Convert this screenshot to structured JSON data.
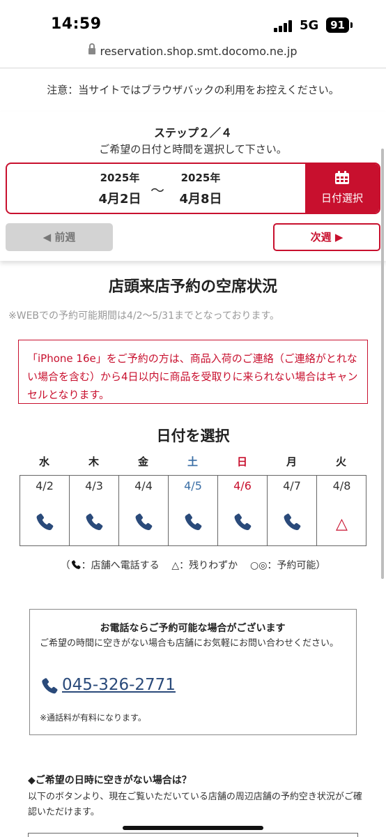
{
  "status_bar": {
    "time": "14:59",
    "network": "5G",
    "battery": "91"
  },
  "browser": {
    "url": "reservation.shop.smt.docomo.ne.jp"
  },
  "notice": "注意：当サイトではブラウザバックの利用をお控えください。",
  "step": {
    "label": "ステップ２／４",
    "instruction": "ご希望の日付と時間を選択して下さい。"
  },
  "date_range": {
    "from_year": "2025年",
    "from_date": "4月2日",
    "separator": "〜",
    "to_year": "2025年",
    "to_date": "4月8日",
    "select_label": "日付選択"
  },
  "nav": {
    "prev_label": "◀ 前週",
    "next_label": "次週 ▶"
  },
  "section_title": "店頭来店予約の空席状況",
  "period_note": "※WEBでの予約可能期間は4/2〜5/31までとなっております。",
  "warning": "「iPhone 16e」をご予約の方は、商品入荷のご連絡（ご連絡がとれない場合を含む）から4日以内に商品を受取りに来られない場合はキャンセルとなります。",
  "date_select_title": "日付を選択",
  "calendar": {
    "days": [
      {
        "dow": "水",
        "date": "4/2",
        "status": "phone-icon"
      },
      {
        "dow": "木",
        "date": "4/3",
        "status": "phone-icon"
      },
      {
        "dow": "金",
        "date": "4/4",
        "status": "phone-icon"
      },
      {
        "dow": "土",
        "date": "4/5",
        "status": "phone-icon",
        "color": "#3a6ea5"
      },
      {
        "dow": "日",
        "date": "4/6",
        "status": "phone-icon",
        "color": "#c8102e"
      },
      {
        "dow": "月",
        "date": "4/7",
        "status": "phone-icon"
      },
      {
        "dow": "火",
        "date": "4/8",
        "status": "△"
      }
    ]
  },
  "legend": {
    "open": "（",
    "phone": "：店舗へ電話する",
    "few": "△：残りわずか",
    "available": "○◎：予約可能）"
  },
  "phone_box": {
    "title": "お電話ならご予約可能な場合がございます",
    "description": "ご希望の時間に空きがない場合も店舗にお気軽にお問い合わせください。",
    "number": "045-326-2771",
    "fee_note": "※通話料が有料になります。"
  },
  "alternative": {
    "heading": "◆ご希望の日時に空きがない場合は？",
    "description": "以下のボタンより、現在ご覧いただいている店舗の周辺店舗の予約空き状況がご確認いただけます。"
  },
  "colors": {
    "accent": "#c8102e",
    "phone_icon": "#2a4a7a",
    "saturday": "#3a6ea5",
    "sunday": "#c8102e"
  }
}
